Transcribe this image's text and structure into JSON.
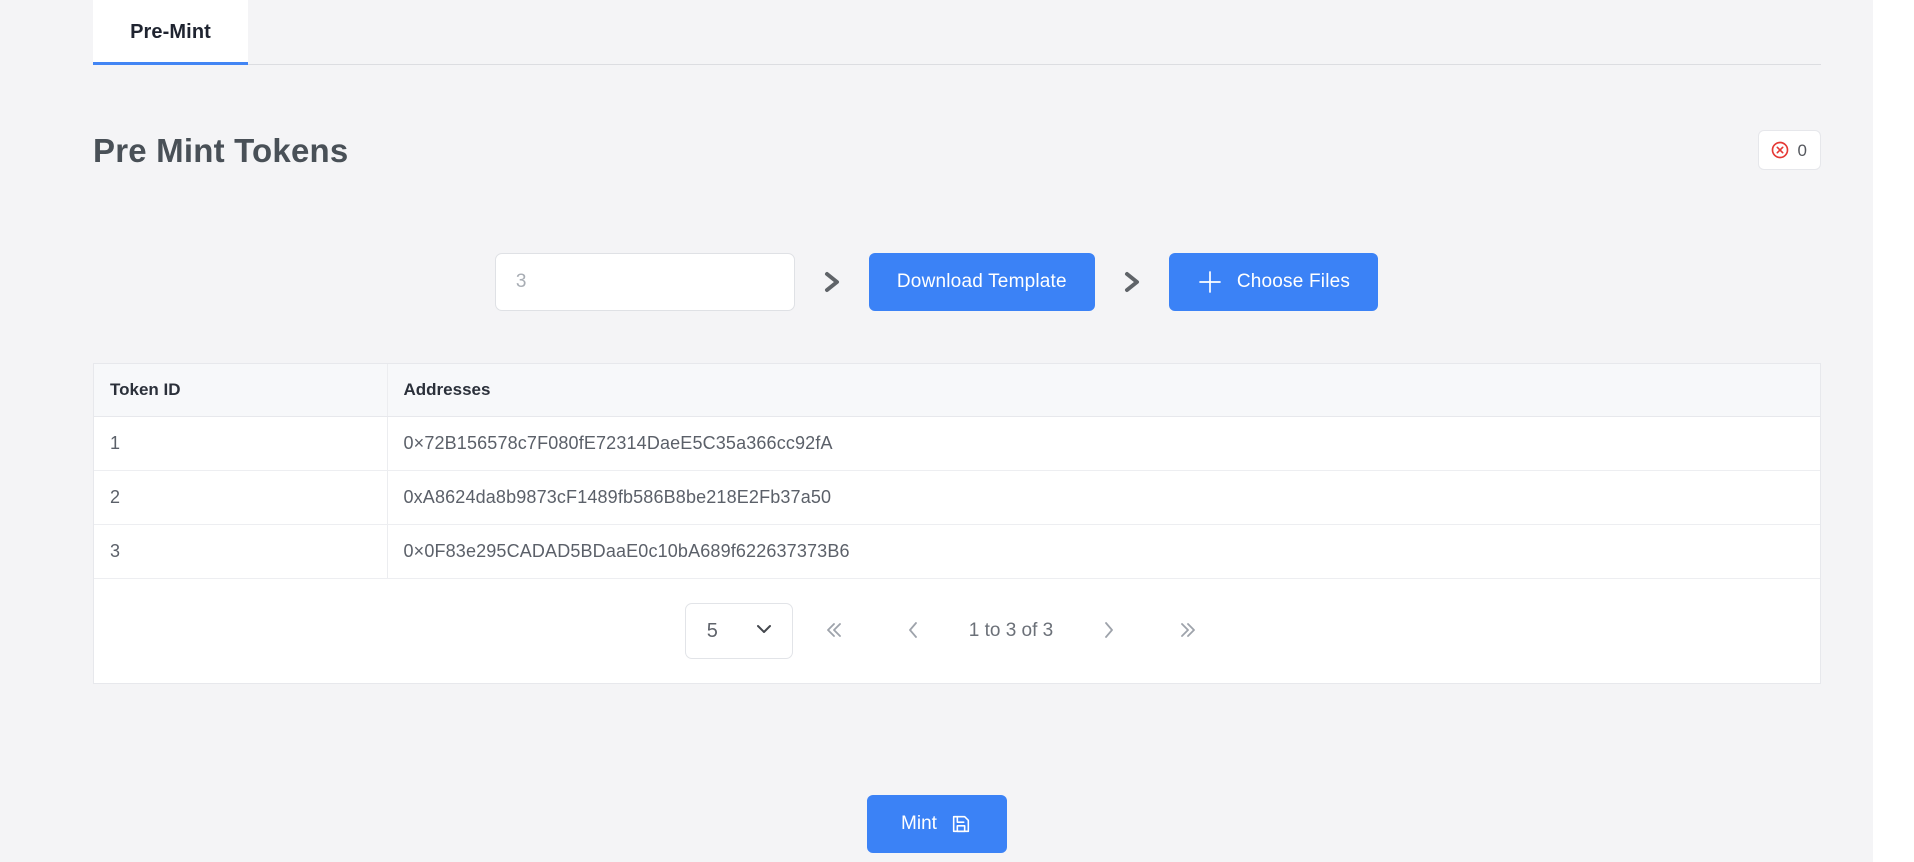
{
  "tabs": [
    {
      "label": "Pre-Mint",
      "active": true
    }
  ],
  "header": {
    "title": "Pre Mint Tokens",
    "error_badge": {
      "icon": "error-circle-x-icon",
      "count": "0",
      "color": "#e53935"
    }
  },
  "stepper": {
    "count_input": {
      "value": "",
      "placeholder": "3"
    },
    "separator_icon": "chevron-right-icon",
    "download_button": {
      "label": "Download Template"
    },
    "choose_files_button": {
      "label": "Choose Files",
      "icon": "plus-icon"
    },
    "accent_color": "#3b82f6"
  },
  "table": {
    "columns": [
      "Token ID",
      "Addresses"
    ],
    "rows": [
      {
        "id": "1",
        "address": "0×72B156578c7F080fE72314DaeE5C35a366cc92fA"
      },
      {
        "id": "2",
        "address": "0xA8624da8b9873cF1489fb586B8be218E2Fb37a50"
      },
      {
        "id": "3",
        "address": "0×0F83e295CADAD5BDaaE0c10bA689f622637373B6"
      }
    ]
  },
  "pagination": {
    "page_size": "5",
    "page_size_icon": "chevron-down-icon",
    "first_icon": "double-chevron-left-icon",
    "prev_icon": "chevron-left-icon",
    "range_label": "1 to 3 of 3",
    "next_icon": "chevron-right-icon",
    "last_icon": "double-chevron-right-icon"
  },
  "footer": {
    "mint_button": {
      "label": "Mint",
      "icon": "save-floppy-icon"
    }
  }
}
